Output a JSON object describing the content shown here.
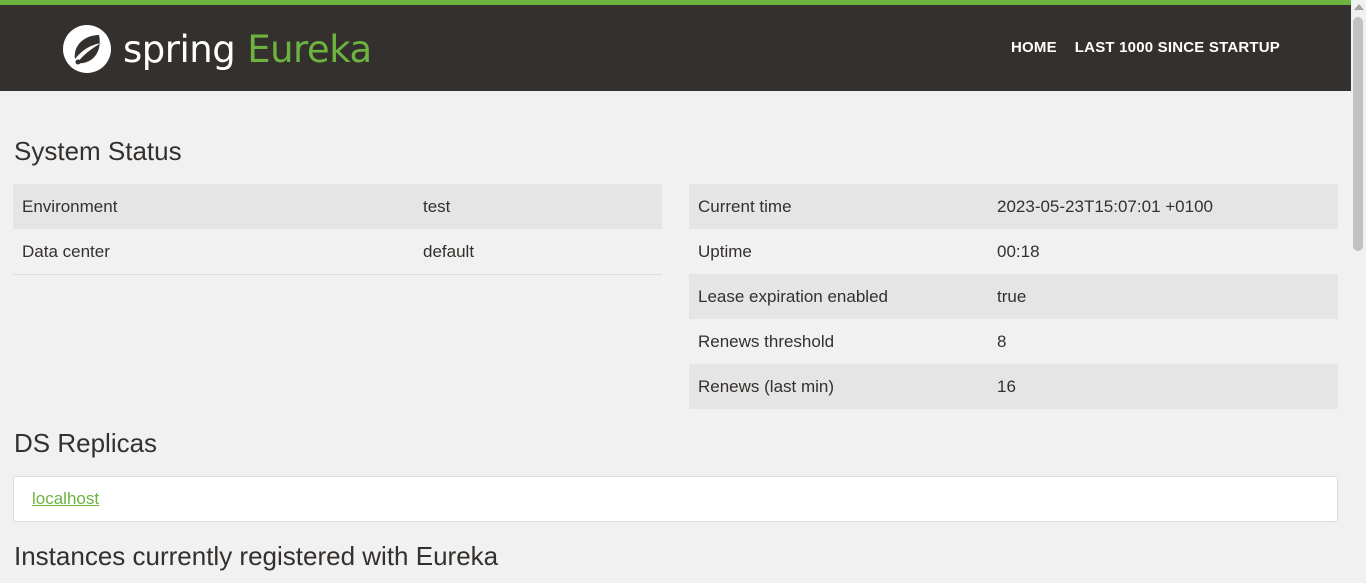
{
  "app": {
    "logo_text_primary": "spring",
    "logo_text_secondary": "Eureka",
    "colors": {
      "brand_green": "#6db33f",
      "nav_background": "#34302d",
      "page_background": "#f1f1f1"
    }
  },
  "nav": {
    "home_label": "HOME",
    "last_1000_label": "LAST 1000 SINCE STARTUP"
  },
  "system_status": {
    "title": "System Status",
    "left": [
      {
        "label": "Environment",
        "value": "test"
      },
      {
        "label": "Data center",
        "value": "default"
      }
    ],
    "right": [
      {
        "label": "Current time",
        "value": "2023-05-23T15:07:01 +0100"
      },
      {
        "label": "Uptime",
        "value": "00:18"
      },
      {
        "label": "Lease expiration enabled",
        "value": "true"
      },
      {
        "label": "Renews threshold",
        "value": "8"
      },
      {
        "label": "Renews (last min)",
        "value": "16"
      }
    ]
  },
  "ds_replicas": {
    "title": "DS Replicas",
    "items": [
      "localhost"
    ]
  },
  "instances": {
    "title": "Instances currently registered with Eureka"
  }
}
